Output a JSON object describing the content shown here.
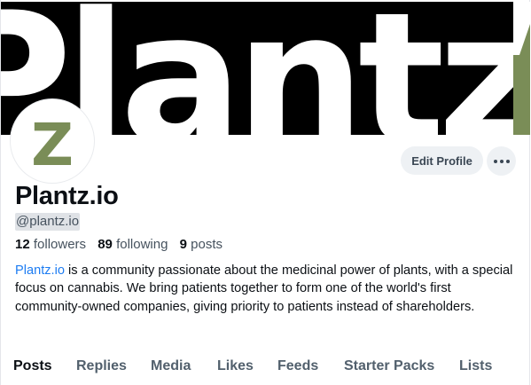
{
  "profile": {
    "display_name": "Plantz.io",
    "handle": "@plantz.io",
    "avatar_letter": "Z",
    "banner_text": "Plantz",
    "brand_color": "#7a8d57"
  },
  "actions": {
    "edit_profile_label": "Edit Profile",
    "more_icon": "ellipsis-icon"
  },
  "stats": {
    "followers_count": "12",
    "followers_label": "followers",
    "following_count": "89",
    "following_label": "following",
    "posts_count": "9",
    "posts_label": "posts"
  },
  "bio": {
    "link_text": "Plantz.io",
    "text": " is a community passionate about the medicinal power of plants, with a special focus on cannabis. We bring patients together to form one of the world's first community-owned companies, giving priority to patients instead of shareholders."
  },
  "tabs": [
    {
      "label": "Posts",
      "active": true
    },
    {
      "label": "Replies",
      "active": false
    },
    {
      "label": "Media",
      "active": false
    },
    {
      "label": "Likes",
      "active": false
    },
    {
      "label": "Feeds",
      "active": false
    },
    {
      "label": "Starter Packs",
      "active": false
    },
    {
      "label": "Lists",
      "active": false
    }
  ]
}
